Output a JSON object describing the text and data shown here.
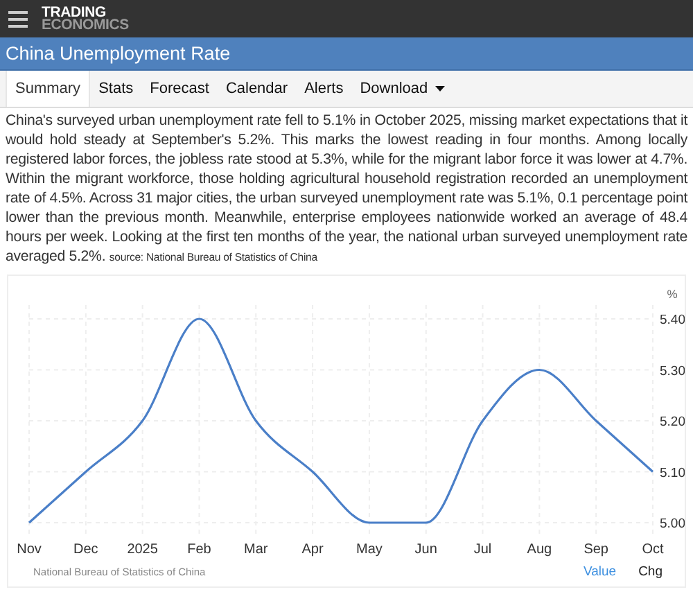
{
  "header": {
    "logo_top": "TRADING",
    "logo_bottom": "ECONOMICS"
  },
  "title": "China Unemployment Rate",
  "tabs": [
    {
      "label": "Summary",
      "selected": true
    },
    {
      "label": "Stats",
      "selected": false
    },
    {
      "label": "Forecast",
      "selected": false
    },
    {
      "label": "Calendar",
      "selected": false
    },
    {
      "label": "Alerts",
      "selected": false
    },
    {
      "label": "Download",
      "selected": false,
      "kind": "dropdown"
    }
  ],
  "summary": {
    "text": "China's surveyed urban unemployment rate fell to 5.1% in October 2025, missing market expectations that it would hold steady at September's 5.2%. This marks the lowest reading in four months. Among locally registered labor forces, the jobless rate stood at 5.3%, while for the migrant labor force it was lower at 4.7%. Within the migrant workforce, those holding agricultural household registration recorded an unemployment rate of 4.5%. Across 31 major cities, the urban surveyed unemployment rate was 5.1%, 0.1 percentage point lower than the previous month. Meanwhile, enterprise employees nationwide worked an average of 48.4 hours per week. Looking at the first ten months of the year, the national urban surveyed unemployment rate averaged 5.2%.",
    "source": "source: National Bureau of Statistics of China"
  },
  "chart": {
    "unit": "%",
    "source": "National Bureau of Statistics of China",
    "chart_data": {
      "type": "line",
      "categories": [
        "Nov",
        "Dec",
        "2025",
        "Feb",
        "Mar",
        "Apr",
        "May",
        "Jun",
        "Jul",
        "Aug",
        "Sep",
        "Oct"
      ],
      "grid": true,
      "series": [
        {
          "name": "Value",
          "color": "#4a7fc8",
          "values": [
            5.0,
            5.1,
            5.2,
            5.4,
            5.2,
            5.1,
            5.0,
            5.0,
            5.2,
            5.3,
            5.2,
            5.1
          ]
        }
      ],
      "ylim": [
        5.0,
        5.4
      ],
      "yticks": [
        {
          "value": 5.0,
          "label": "5.00"
        },
        {
          "value": 5.1,
          "label": "5.10"
        },
        {
          "value": 5.2,
          "label": "5.20"
        },
        {
          "value": 5.3,
          "label": "5.30"
        },
        {
          "value": 5.4,
          "label": "5.40"
        }
      ]
    },
    "value_toggle": {
      "selected": true
    },
    "change_toggle": {
      "label": "Chg",
      "selected": false
    }
  }
}
